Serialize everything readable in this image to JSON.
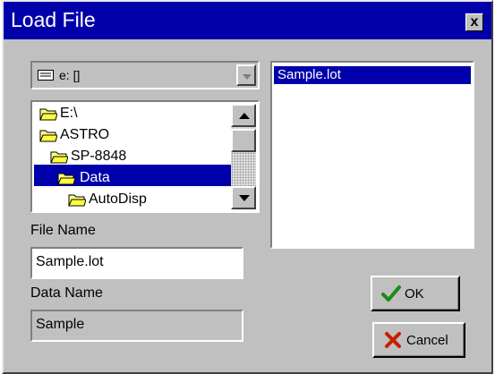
{
  "window": {
    "title": "Load File",
    "close_glyph": "x"
  },
  "drive": {
    "label": "e: []",
    "icon": "drive-icon",
    "arrow_icon": "chevron-down-icon"
  },
  "tree": {
    "items": [
      {
        "label": "E:\\",
        "selected": false
      },
      {
        "label": "ASTRO",
        "selected": false
      },
      {
        "label": "SP-8848",
        "selected": false
      },
      {
        "label": "Data",
        "selected": true
      },
      {
        "label": "AutoDisp",
        "selected": false
      }
    ]
  },
  "file_name": {
    "label": "File Name",
    "value": "Sample.lot"
  },
  "data_name": {
    "label": "Data Name",
    "value": "Sample"
  },
  "files": {
    "items": [
      "Sample.lot"
    ],
    "selected_index": 0
  },
  "buttons": {
    "ok": "OK",
    "cancel": "Cancel"
  },
  "colors": {
    "title_bar": "#0000aa",
    "selection": "#0000aa",
    "face": "#c0c0c0",
    "ok_check": "#1a8a1a",
    "cancel_x": "#c81e00"
  }
}
